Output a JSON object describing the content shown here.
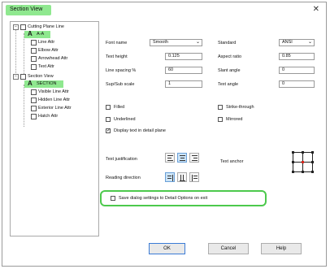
{
  "window": {
    "title": "Section View",
    "close_glyph": "✕"
  },
  "tree": {
    "items": [
      {
        "label": "Cutting Plane Line",
        "level": 0
      },
      {
        "label": "A-A",
        "level": 1,
        "highlighted": true
      },
      {
        "label": "Line Attr",
        "level": 2
      },
      {
        "label": "Elbow Attr",
        "level": 2
      },
      {
        "label": "Arrowhead Attr",
        "level": 2
      },
      {
        "label": "Text Attr",
        "level": 2
      },
      {
        "label": "Section View",
        "level": 0
      },
      {
        "label": "SECTION",
        "level": 1,
        "highlighted": true
      },
      {
        "label": "Visible Line Attr",
        "level": 2
      },
      {
        "label": "Hidden Line Attr",
        "level": 2
      },
      {
        "label": "Exterior Line Attr",
        "level": 2
      },
      {
        "label": "Hatch Attr",
        "level": 2
      }
    ]
  },
  "form": {
    "font_name_label": "Font name",
    "font_name_value": "Smooth",
    "text_height_label": "Text height",
    "text_height_value": "0.125",
    "line_spacing_label": "Line spacing %",
    "line_spacing_value": "60",
    "sup_sub_label": "Sup/Sub scale",
    "sup_sub_value": "1",
    "standard_label": "Standard",
    "standard_value": "ANSI",
    "aspect_ratio_label": "Aspect ratio",
    "aspect_ratio_value": "0.85",
    "slant_angle_label": "Slant angle",
    "slant_angle_value": "0",
    "text_angle_label": "Text angle",
    "text_angle_value": "0"
  },
  "options": {
    "filled": "Filled",
    "underlined": "Underlined",
    "display_text": "Display text in detail plane",
    "strike_through": "Strike-through",
    "mirrored": "Mirrored",
    "display_text_checked": "✓"
  },
  "layout_section": {
    "text_justification": "Text justification",
    "reading_direction": "Reading direction",
    "text_anchor": "Text anchor"
  },
  "save_option": {
    "label": "Save dialog settings to Detail Options on exit"
  },
  "buttons": {
    "ok": "OK",
    "cancel": "Cancel",
    "help": "Help"
  },
  "colors": {
    "highlight": "#8fe88f",
    "annotation_border": "#4cc94c",
    "anchor_selected": "#d9261c"
  }
}
